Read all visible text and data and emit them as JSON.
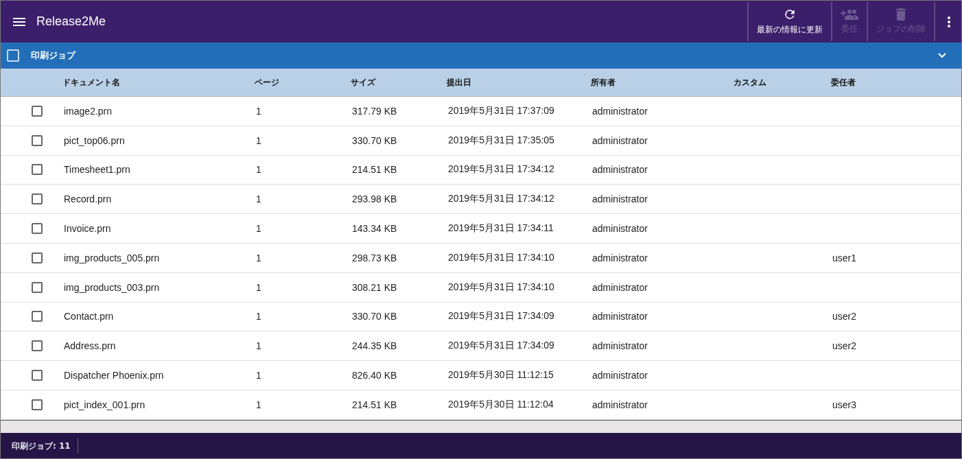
{
  "app_bar": {
    "title": "Release2Me",
    "actions": [
      {
        "kind": "refresh",
        "label": "最新の情報に更新",
        "disabled": false
      },
      {
        "kind": "delegate",
        "label": "委任",
        "disabled": true
      },
      {
        "kind": "delete",
        "label": "ジョブの削除",
        "disabled": true
      }
    ]
  },
  "section": {
    "title": "印刷ジョブ",
    "checked": false,
    "expanded": true
  },
  "table": {
    "columns": [
      "ドキュメント名",
      "ページ",
      "サイズ",
      "提出日",
      "所有者",
      "カスタム",
      "委任者"
    ],
    "rows": [
      {
        "checked": false,
        "cells": [
          "image2.prn",
          "1",
          "317.79 KB",
          "2019年5月31日 17:37:09",
          "administrator",
          "",
          ""
        ]
      },
      {
        "checked": false,
        "cells": [
          "pict_top06.prn",
          "1",
          "330.70 KB",
          "2019年5月31日 17:35:05",
          "administrator",
          "",
          ""
        ]
      },
      {
        "checked": false,
        "cells": [
          "Timesheet1.prn",
          "1",
          "214.51 KB",
          "2019年5月31日 17:34:12",
          "administrator",
          "",
          ""
        ]
      },
      {
        "checked": false,
        "cells": [
          "Record.prn",
          "1",
          "293.98 KB",
          "2019年5月31日 17:34:12",
          "administrator",
          "",
          ""
        ]
      },
      {
        "checked": false,
        "cells": [
          "Invoice.prn",
          "1",
          "143.34 KB",
          "2019年5月31日 17:34:11",
          "administrator",
          "",
          ""
        ]
      },
      {
        "checked": false,
        "cells": [
          "img_products_005.prn",
          "1",
          "298.73 KB",
          "2019年5月31日 17:34:10",
          "administrator",
          "",
          "user1"
        ]
      },
      {
        "checked": false,
        "cells": [
          "img_products_003.prn",
          "1",
          "308.21 KB",
          "2019年5月31日 17:34:10",
          "administrator",
          "",
          ""
        ]
      },
      {
        "checked": false,
        "cells": [
          "Contact.prn",
          "1",
          "330.70 KB",
          "2019年5月31日 17:34:09",
          "administrator",
          "",
          "user2"
        ]
      },
      {
        "checked": false,
        "cells": [
          "Address.prn",
          "1",
          "244.35 KB",
          "2019年5月31日 17:34:09",
          "administrator",
          "",
          "user2"
        ]
      },
      {
        "checked": false,
        "cells": [
          "Dispatcher Phoenix.prn",
          "1",
          "826.40 KB",
          "2019年5月30日 11:12:15",
          "administrator",
          "",
          ""
        ]
      },
      {
        "checked": false,
        "cells": [
          "pict_index_001.prn",
          "1",
          "214.51 KB",
          "2019年5月30日 11:12:04",
          "administrator",
          "",
          "user3"
        ]
      }
    ]
  },
  "status_bar": {
    "text": "印刷ジョブ: 11"
  }
}
